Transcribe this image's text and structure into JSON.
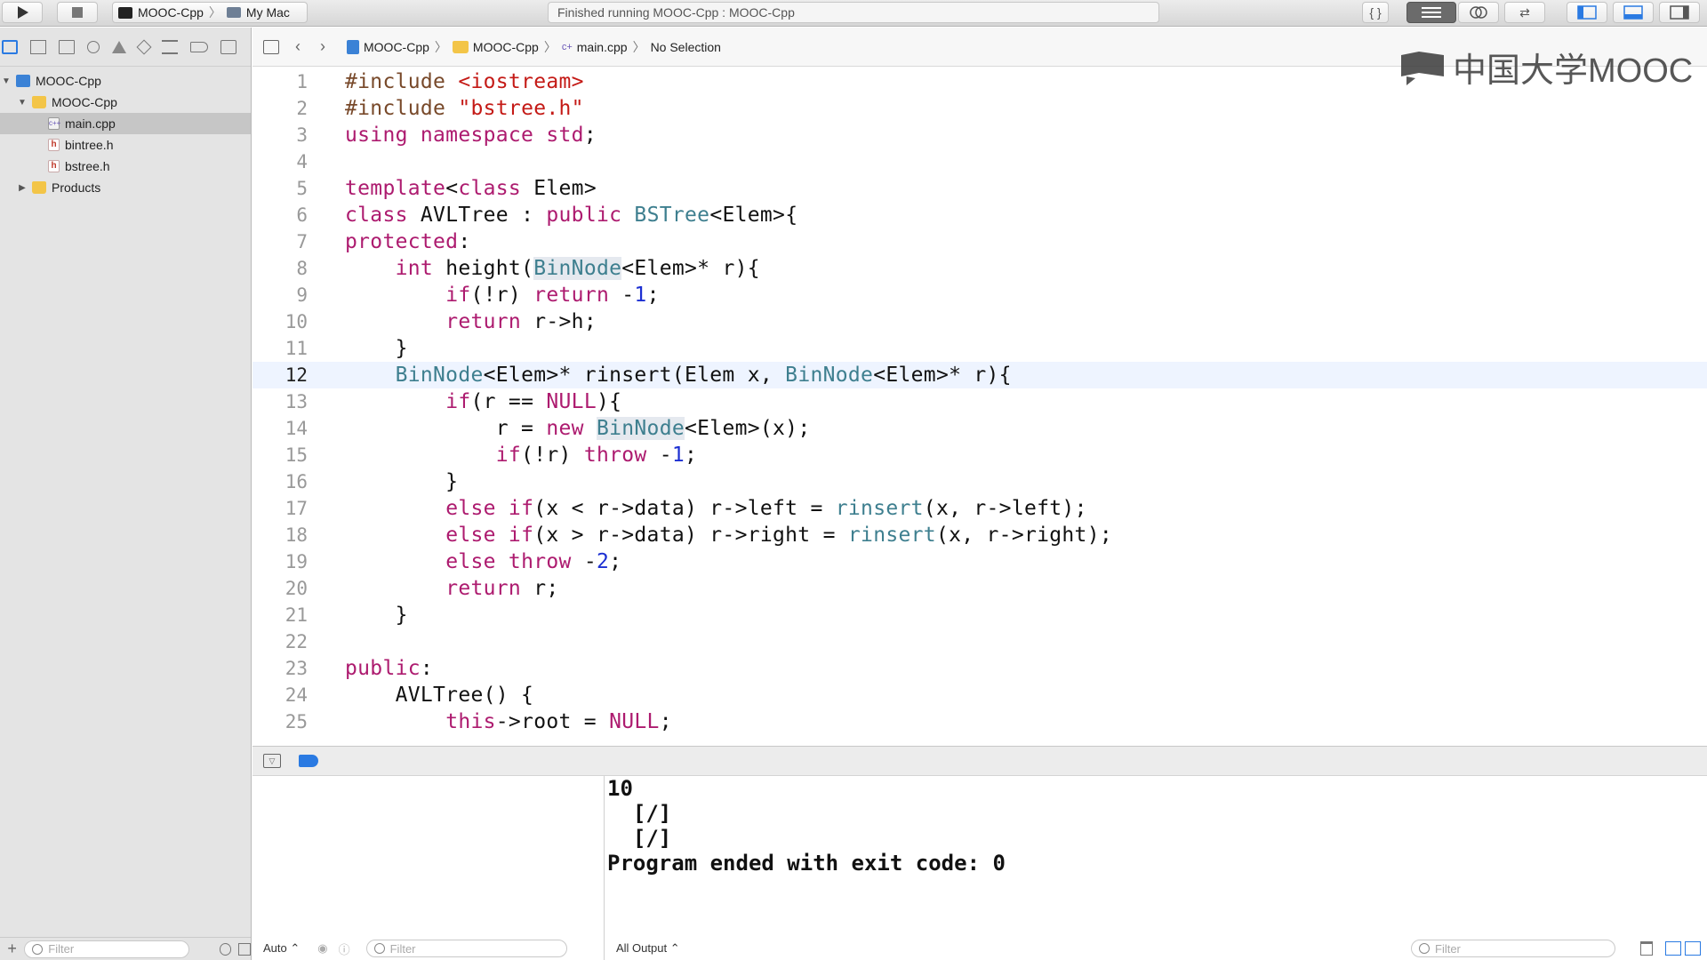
{
  "toolbar": {
    "scheme_name": "MOOC-Cpp",
    "destination": "My Mac",
    "status_text": "Finished running MOOC-Cpp : MOOC-Cpp"
  },
  "navigator": {
    "items": [
      {
        "label": "MOOC-Cpp",
        "icon": "project-icon"
      },
      {
        "label": "MOOC-Cpp",
        "icon": "folder-icon"
      },
      {
        "label": "main.cpp",
        "icon": "cpp-file-icon"
      },
      {
        "label": "bintree.h",
        "icon": "header-file-icon"
      },
      {
        "label": "bstree.h",
        "icon": "header-file-icon"
      },
      {
        "label": "Products",
        "icon": "folder-icon"
      }
    ],
    "filter_placeholder": "Filter"
  },
  "jumpbar": {
    "crumbs": [
      "MOOC-Cpp",
      "MOOC-Cpp",
      "main.cpp",
      "No Selection"
    ]
  },
  "watermark": "中国大学MOOC",
  "editor": {
    "current_line": 12,
    "line_numbers": [
      "1",
      "2",
      "3",
      "4",
      "5",
      "6",
      "7",
      "8",
      "9",
      "10",
      "11",
      "12",
      "13",
      "14",
      "15",
      "16",
      "17",
      "18",
      "19",
      "20",
      "21",
      "22",
      "23",
      "24",
      "25"
    ]
  },
  "debug": {
    "auto_label": "Auto ⌃",
    "variables_filter_placeholder": "Filter",
    "output_selector": "All Output ⌃",
    "console_filter_placeholder": "Filter",
    "console_lines": [
      "10",
      "  [/]",
      "  [/]",
      "Program ended with exit code: 0"
    ]
  },
  "colors": {
    "keyword": "#ad1b6f",
    "type": "#3e7f8f",
    "number": "#1c2fd2",
    "string": "#c41a16",
    "current_line": "#eef4ff"
  }
}
